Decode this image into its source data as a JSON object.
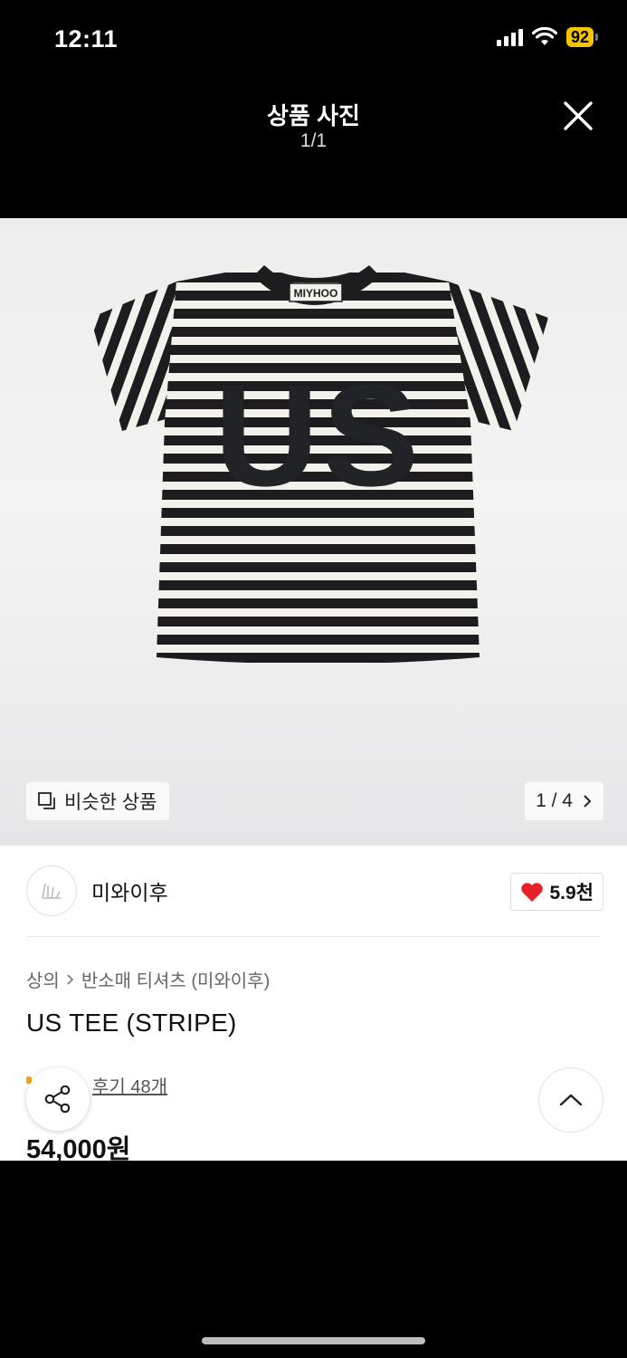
{
  "status_bar": {
    "time": "12:11",
    "battery": "92"
  },
  "header": {
    "title": "상품 사진",
    "counter": "1/1"
  },
  "image": {
    "neck_label": "MIYHOO",
    "print_text": "US",
    "similar_label": "비슷한 상품",
    "pager_label": "1 / 4"
  },
  "brand": {
    "name": "미와이후",
    "likes": "5.9천"
  },
  "breadcrumb": {
    "category": "상의",
    "subcategory": "반소매 티셔츠 (미와이후)"
  },
  "product": {
    "name": "US TEE (STRIPE)",
    "reviews": "후기 48개",
    "price": "54,000원"
  },
  "colors": {
    "heart": "#e8202a",
    "rating_star": "#f7a21b"
  }
}
